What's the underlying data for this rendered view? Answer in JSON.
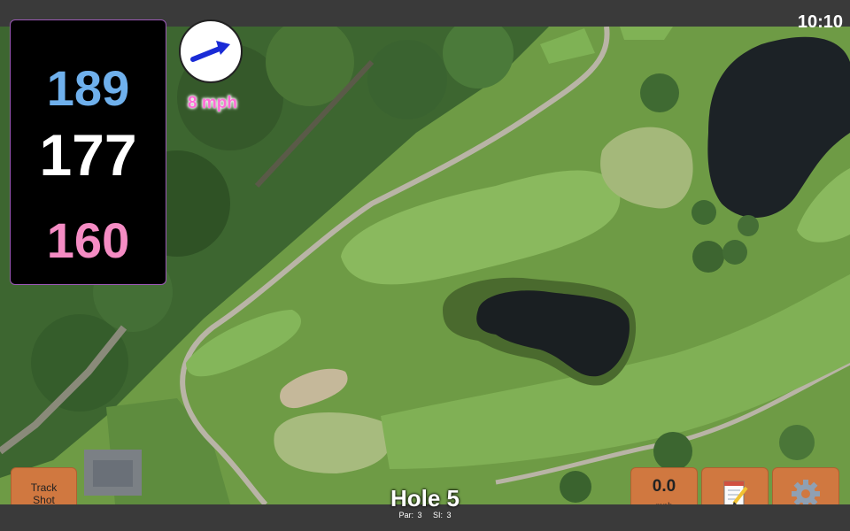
{
  "status": {
    "time": "10:10"
  },
  "distances": {
    "back": "189",
    "middle": "177",
    "front": "160"
  },
  "wind": {
    "speed": "8 mph",
    "icon": "wind-arrow-icon"
  },
  "buttons": {
    "track_shot": "Track Shot",
    "speed_value": "0.0",
    "speed_unit": "mph",
    "notes_icon": "notepad-icon",
    "settings_icon": "gear-icon"
  },
  "hole": {
    "title": "Hole 5",
    "par": "Par: 3",
    "si": "SI: 3"
  },
  "colors": {
    "accent_button": "#d07840",
    "back_distance": "#6fb0ec",
    "front_distance": "#f58cc4",
    "wind_label": "#ff6dd7"
  }
}
